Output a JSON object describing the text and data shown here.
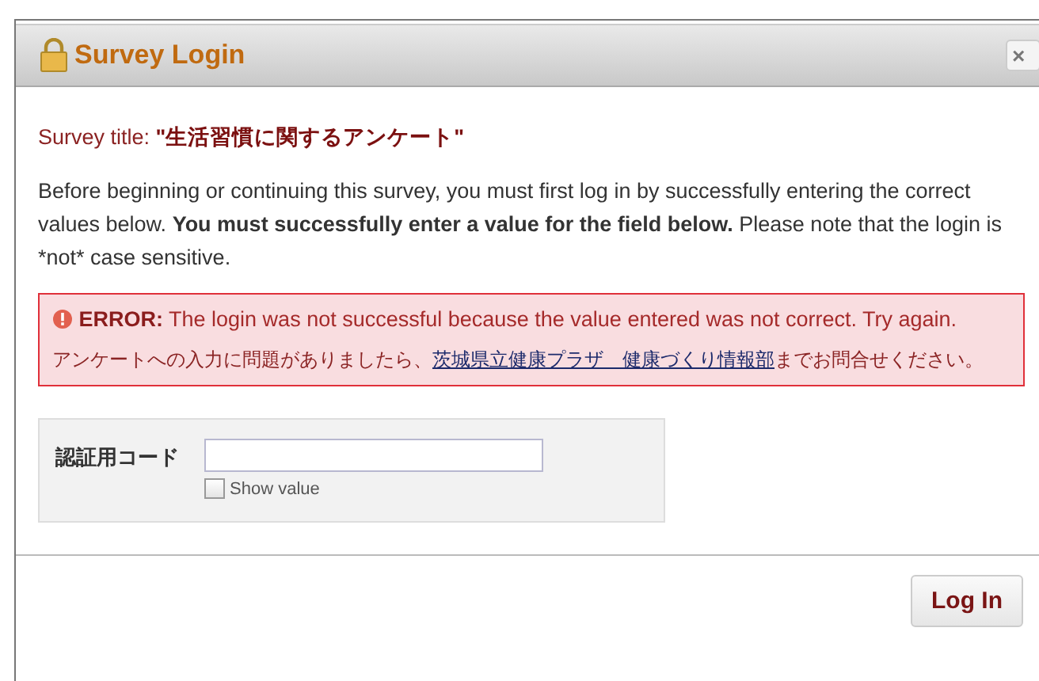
{
  "dialog": {
    "title": "Survey Login",
    "close": "×"
  },
  "survey_title": {
    "label": "Survey title: ",
    "value": "\"生活習慣に関するアンケート\""
  },
  "instructions": {
    "before": "Before beginning or continuing this survey, you must first log in by successfully entering the correct values below. ",
    "emphasis": "You must successfully enter a value for the field below.",
    "after": " Please note that the login is *not* case sensitive."
  },
  "error": {
    "label": "ERROR:",
    "message": " The login was not successful because the value entered was not correct. Try again.",
    "contact_before": "アンケートへの入力に問題がありましたら、",
    "contact_link": "茨城県立健康プラザ　健康づくり情報部",
    "contact_after": "までお問合せください。"
  },
  "login_field": {
    "label": "認証用コード"
  },
  "show_value": {
    "label": "Show value",
    "checked": false
  },
  "button": "Log In"
}
